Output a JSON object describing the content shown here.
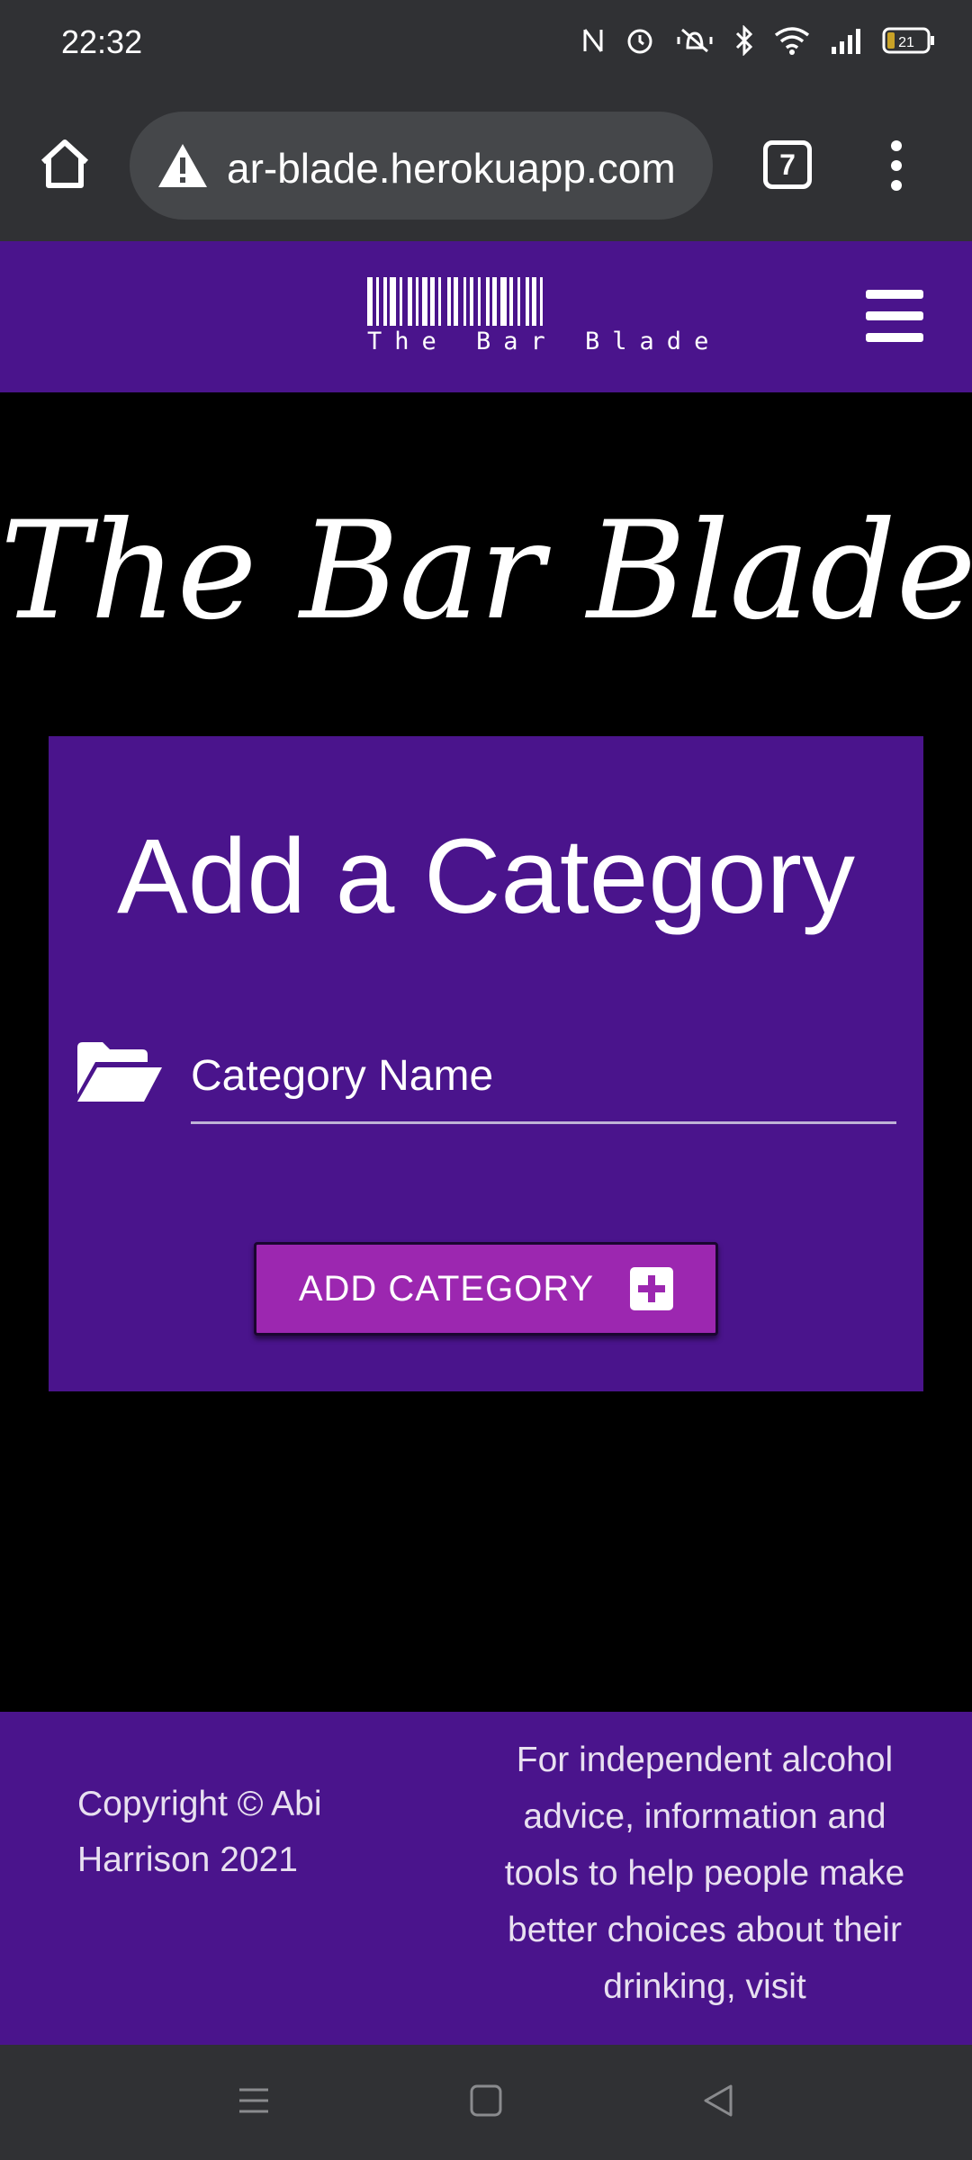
{
  "status_bar": {
    "time": "22:32",
    "battery": "21",
    "icons": [
      "nfc-icon",
      "alarm-icon",
      "vibrate-icon",
      "bluetooth-icon",
      "wifi-icon",
      "signal-icon",
      "battery-icon"
    ]
  },
  "browser": {
    "url": "ar-blade.herokuapp.com",
    "tab_count": "7"
  },
  "navbar": {
    "brand_text": "The Bar Blade"
  },
  "hero": {
    "title": "The Bar Blade"
  },
  "form": {
    "title": "Add a Category",
    "field_label": "Category Name",
    "submit_label": "ADD CATEGORY"
  },
  "footer": {
    "copyright": "Copyright © Abi Harrison 2021",
    "info": "For independent alcohol advice, information and tools to help people make better choices about their drinking, visit"
  },
  "colors": {
    "brand_purple": "#4a148c",
    "button_purple": "#9c27b0",
    "chrome_gray": "#303134"
  }
}
